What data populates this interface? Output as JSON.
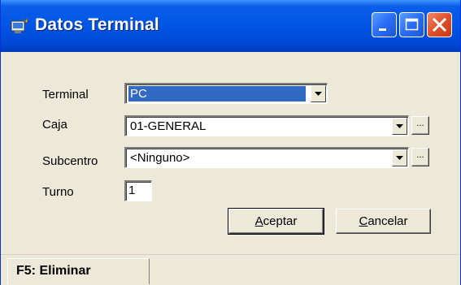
{
  "window": {
    "title": "Datos Terminal",
    "controls": {
      "minimize_icon": "minimize-icon",
      "maximize_icon": "maximize-icon",
      "close_icon": "close-icon"
    }
  },
  "form": {
    "terminal": {
      "label": "Terminal",
      "value": "PC"
    },
    "caja": {
      "label": "Caja",
      "value": "01-GENERAL",
      "browse": "..."
    },
    "subcentro": {
      "label": "Subcentro",
      "value": "<Ninguno>",
      "browse": "..."
    },
    "turno": {
      "label": "Turno",
      "value": "1"
    }
  },
  "buttons": {
    "accept_accel": "A",
    "accept_rest": "ceptar",
    "cancel_accel": "C",
    "cancel_rest": "ancelar"
  },
  "statusbar": {
    "delete_hint": "F5: Eliminar"
  },
  "colors": {
    "titlebar": "#0055e5",
    "selection": "#316ac5",
    "face": "#ece9d8",
    "close": "#e0502a"
  }
}
